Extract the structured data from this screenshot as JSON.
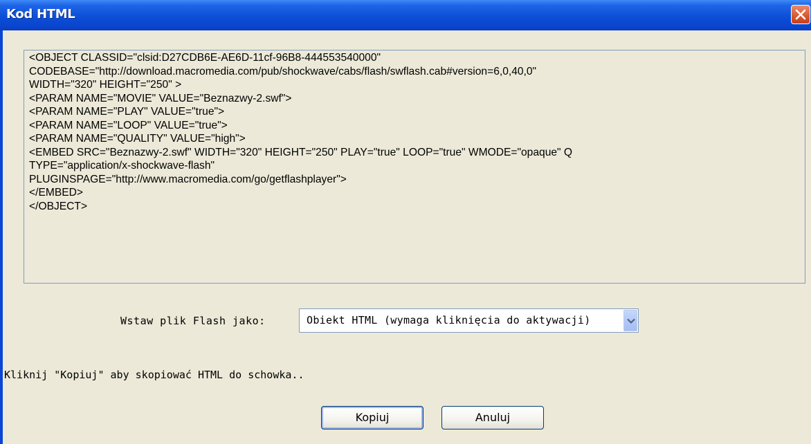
{
  "window": {
    "title": "Kod HTML"
  },
  "code": {
    "lines": [
      "<OBJECT CLASSID=\"clsid:D27CDB6E-AE6D-11cf-96B8-444553540000\"",
      "CODEBASE=\"http://download.macromedia.com/pub/shockwave/cabs/flash/swflash.cab#version=6,0,40,0\"",
      "WIDTH=\"320\" HEIGHT=\"250\" >",
      "<PARAM NAME=\"MOVIE\" VALUE=\"Beznazwy-2.swf\">",
      "<PARAM NAME=\"PLAY\" VALUE=\"true\">",
      "<PARAM NAME=\"LOOP\" VALUE=\"true\">",
      "<PARAM NAME=\"QUALITY\" VALUE=\"high\">",
      "<EMBED SRC=\"Beznazwy-2.swf\" WIDTH=\"320\" HEIGHT=\"250\" PLAY=\"true\" LOOP=\"true\" WMODE=\"opaque\" Q",
      "TYPE=\"application/x-shockwave-flash\"",
      "PLUGINSPAGE=\"http://www.macromedia.com/go/getflashplayer\">",
      "</EMBED>",
      "</OBJECT>"
    ]
  },
  "insert_as": {
    "label": "Wstaw plik Flash jako:",
    "selected": "Obiekt HTML (wymaga kliknięcia do aktywacji)"
  },
  "hint": "Kliknij \"Kopiuj\" aby skopiować HTML do schowka..",
  "buttons": {
    "copy": "Kopiuj",
    "cancel": "Anuluj"
  },
  "colors": {
    "title_bar": "#0a46d6",
    "dialog_bg": "#ece9d8",
    "close_button": "#d8582e"
  },
  "icons": {
    "close": "close-icon",
    "dropdown": "chevron-down-icon"
  }
}
